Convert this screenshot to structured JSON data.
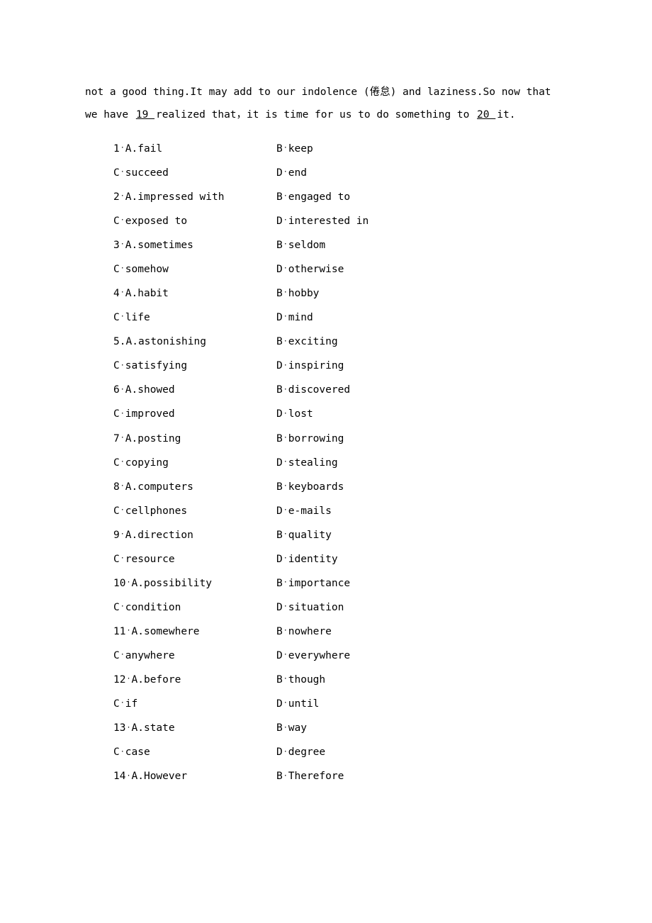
{
  "passage": {
    "pre": "not a good thing.It may add to our indolence (倦怠) and laziness.So now that we have",
    "blank1": "  19  ",
    "mid": "realized that，it is time for us to do something to",
    "blank2": "  20  ",
    "post": " it."
  },
  "dot": "·",
  "labels": {
    "A": "A",
    "B": "B",
    "C": "C",
    "D": "D"
  },
  "questions": [
    {
      "n": "1",
      "sepA": "·",
      "A": "fail",
      "B": "keep",
      "C": "succeed",
      "D": "end"
    },
    {
      "n": "2",
      "sepA": "·",
      "A": "impressed with",
      "B": "engaged to",
      "C": "exposed to",
      "D": "interested in"
    },
    {
      "n": "3",
      "sepA": "·",
      "A": "sometimes",
      "B": "seldom",
      "C": "somehow",
      "D": "otherwise"
    },
    {
      "n": "4",
      "sepA": "·",
      "A": "habit",
      "B": "hobby",
      "C": "life",
      "D": "mind"
    },
    {
      "n": "5",
      "sepA": ".",
      "A": "astonishing",
      "B": "exciting",
      "C": "satisfying",
      "D": "inspiring"
    },
    {
      "n": "6",
      "sepA": "·",
      "A": "showed",
      "B": "discovered",
      "C": "improved",
      "D": "lost"
    },
    {
      "n": "7",
      "sepA": "·",
      "A": "posting",
      "B": "borrowing",
      "C": "copying",
      "D": "stealing"
    },
    {
      "n": "8",
      "sepA": "·",
      "A": "computers",
      "B": "keyboards",
      "C": "cellphones",
      "D": "e-mails"
    },
    {
      "n": "9",
      "sepA": "·",
      "A": "direction",
      "B": "quality",
      "C": "resource",
      "D": "identity"
    },
    {
      "n": "10",
      "sepA": "·",
      "A": "possibility",
      "B": "importance",
      "C": "condition",
      "D": "situation"
    },
    {
      "n": "11",
      "sepA": "·",
      "A": "somewhere",
      "B": "nowhere",
      "C": "anywhere",
      "D": "everywhere"
    },
    {
      "n": "12",
      "sepA": "·",
      "A": "before",
      "B": "though",
      "C": "if",
      "D": "until"
    },
    {
      "n": "13",
      "sepA": "·",
      "A": "state",
      "B": "way",
      "C": "case",
      "D": "degree"
    },
    {
      "n": "14",
      "sepA": "·",
      "A": "However",
      "B": "Therefore",
      "C": "",
      "D": ""
    }
  ],
  "lastHasCD": false
}
